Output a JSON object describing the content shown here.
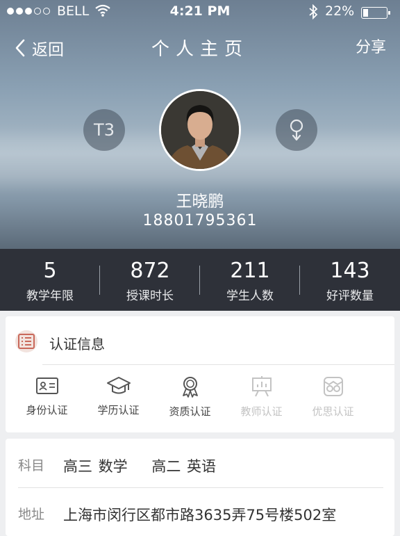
{
  "status_bar": {
    "carrier": "BELL",
    "time": "4:21 PM",
    "battery": "22%",
    "battery_level": 0.22
  },
  "nav": {
    "back_label": "返回",
    "title": "个人主页",
    "share_label": "分享"
  },
  "profile": {
    "level_badge": "T3",
    "gender_icon": "female-icon",
    "name": "王晓鹏",
    "phone": "18801795361"
  },
  "stats": [
    {
      "value": "5",
      "label": "教学年限"
    },
    {
      "value": "872",
      "label": "授课时长"
    },
    {
      "value": "211",
      "label": "学生人数"
    },
    {
      "value": "143",
      "label": "好评数量"
    }
  ],
  "certification": {
    "title": "认证信息",
    "items": [
      {
        "label": "身份认证",
        "icon": "id-card-icon",
        "active": true
      },
      {
        "label": "学历认证",
        "icon": "graduation-cap-icon",
        "active": true
      },
      {
        "label": "资质认证",
        "icon": "award-medal-icon",
        "active": true
      },
      {
        "label": "教师认证",
        "icon": "teacher-board-icon",
        "active": false
      },
      {
        "label": "优思认证",
        "icon": "owl-icon",
        "active": false
      }
    ]
  },
  "details": {
    "subject_label": "科目",
    "subjects": "高三 数学    高二 英语",
    "address_label": "地址",
    "address": "上海市闵行区都市路3635弄75号楼502室"
  },
  "colors": {
    "stats_bg": "#2e3139",
    "accent_badge": "#f2e3de",
    "accent_icon": "#c9685a"
  }
}
